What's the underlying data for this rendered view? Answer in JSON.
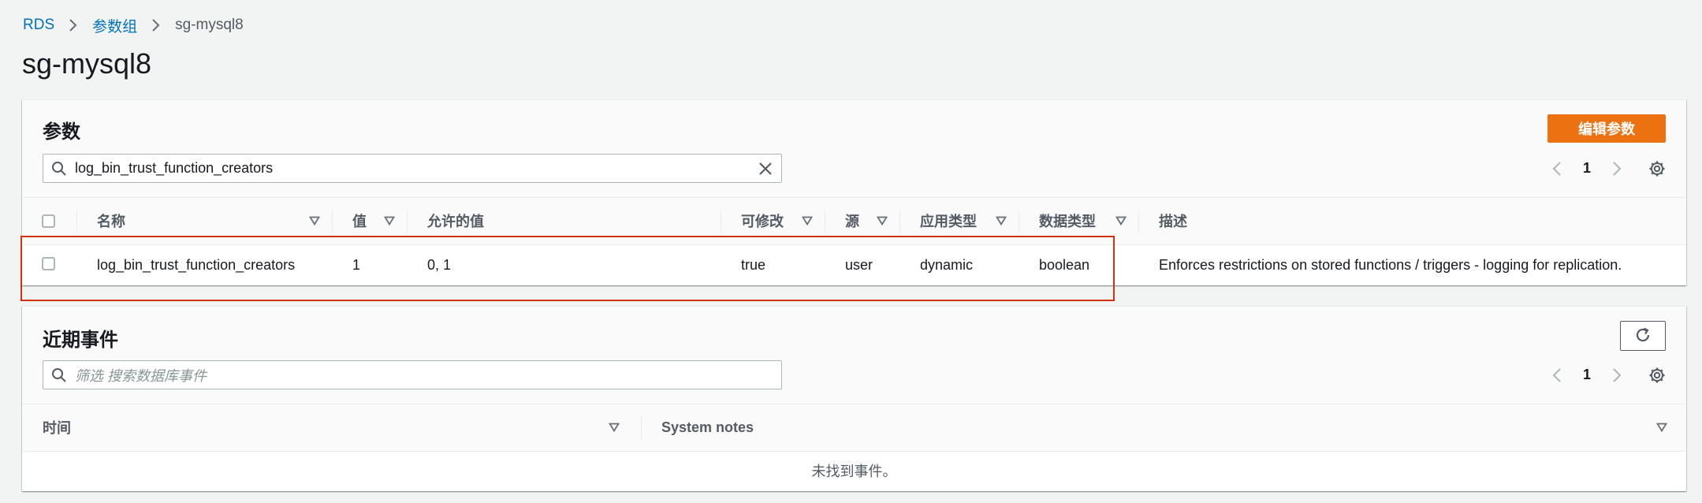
{
  "breadcrumb": {
    "items": [
      "RDS",
      "参数组"
    ],
    "current": "sg-mysql8"
  },
  "page_title": "sg-mysql8",
  "parameters": {
    "title": "参数",
    "edit_button": "编辑参数",
    "search_value": "log_bin_trust_function_creators",
    "page": "1",
    "columns": [
      "名称",
      "值",
      "允许的值",
      "可修改",
      "源",
      "应用类型",
      "数据类型",
      "描述"
    ],
    "rows": [
      {
        "name": "log_bin_trust_function_creators",
        "value": "1",
        "allowed": "0, 1",
        "modifiable": "true",
        "source": "user",
        "apply_type": "dynamic",
        "data_type": "boolean",
        "description": "Enforces restrictions on stored functions / triggers - logging for replication."
      }
    ]
  },
  "events": {
    "title": "近期事件",
    "search_placeholder": "筛选 搜索数据库事件",
    "page": "1",
    "columns": [
      "时间",
      "System notes"
    ],
    "empty_text": "未找到事件。"
  },
  "colors": {
    "link": "#0073bb",
    "primary_button": "#ec7211",
    "highlight": "#d13212"
  }
}
